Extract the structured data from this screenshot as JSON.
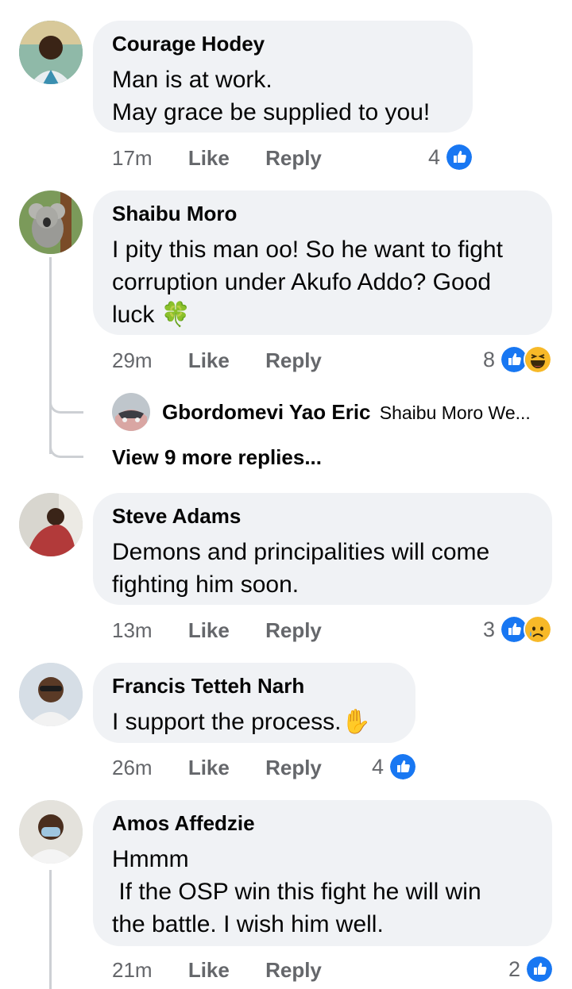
{
  "comments": [
    {
      "name": "Courage Hodey",
      "lines": [
        "Man is at work.",
        "May grace be supplied to you!"
      ],
      "time": "17m",
      "like": "Like",
      "reply": "Reply",
      "reaction_count": "4",
      "reactions": [
        "like-icon"
      ]
    },
    {
      "name": "Shaibu Moro",
      "lines": [
        "I pity this man oo! So he want to fight",
        "corruption under Akufo Addo? Good",
        "luck"
      ],
      "emoji": "🍀",
      "time": "29m",
      "like": "Like",
      "reply": "Reply",
      "reaction_count": "8",
      "reactions": [
        "like-icon",
        "haha-icon"
      ],
      "reply_preview": {
        "name": "Gbordomevi Yao Eric",
        "text": "Shaibu Moro We...",
        "view_more": "View 9 more replies..."
      }
    },
    {
      "name": "Steve Adams",
      "lines": [
        "Demons and principalities will come",
        "fighting him soon."
      ],
      "time": "13m",
      "like": "Like",
      "reply": "Reply",
      "reaction_count": "3",
      "reactions": [
        "like-icon",
        "sad-icon"
      ]
    },
    {
      "name": "Francis Tetteh Narh",
      "lines": [
        "I support the process."
      ],
      "emoji": "✋",
      "time": "26m",
      "like": "Like",
      "reply": "Reply",
      "reaction_count": "4",
      "reactions": [
        "like-icon"
      ]
    },
    {
      "name": "Amos Affedzie",
      "lines": [
        "Hmmm",
        " If the OSP win this fight he will win",
        "the battle. I wish him well."
      ],
      "time": "21m",
      "like": "Like",
      "reply": "Reply",
      "reaction_count": "2",
      "reactions": [
        "like-icon"
      ]
    }
  ],
  "colors": {
    "bubble": "#f0f2f5",
    "meta": "#65676b",
    "like_blue": "#1877f2",
    "haha_yellow": "#f7b928"
  }
}
